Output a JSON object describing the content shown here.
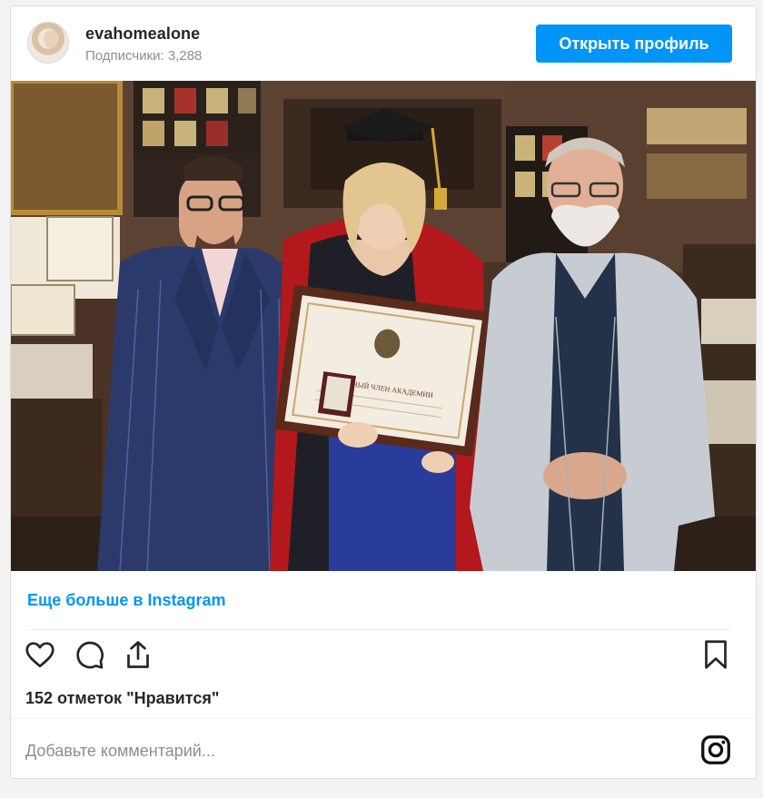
{
  "header": {
    "username": "evahomealone",
    "followers": "Подписчики: 3,288",
    "open_profile_label": "Открыть профиль"
  },
  "photo": {
    "diploma_title": "ПОЧЁТНЫЙ ЧЛЕН АКАДЕМИИ"
  },
  "footer": {
    "more_link": "Еще больше в Instagram",
    "likes": "152 отметок \"Нравится\"",
    "comment_placeholder": "Добавьте комментарий..."
  },
  "icons": {
    "like": "heart-icon",
    "comment": "comment-icon",
    "share": "share-icon",
    "save": "bookmark-icon",
    "instagram": "instagram-icon"
  },
  "colors": {
    "accent": "#0095f6",
    "text": "#262626",
    "muted": "#8e8e8e"
  }
}
